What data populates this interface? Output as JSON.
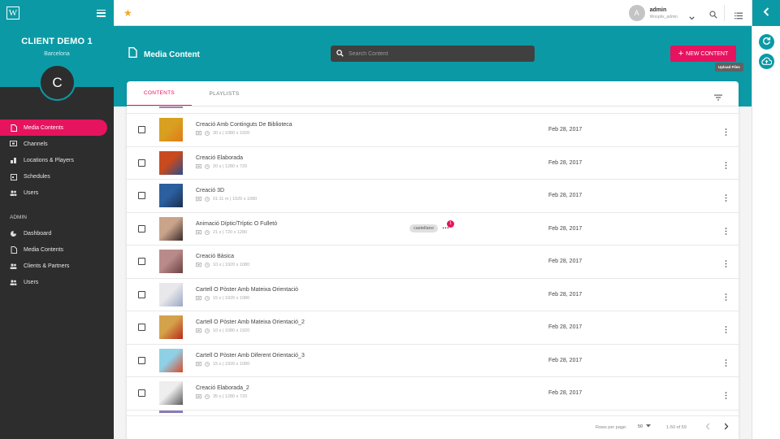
{
  "sidebar": {
    "logo": "W",
    "client_name": "CLIENT DEMO 1",
    "client_city": "Barcelona",
    "avatar_letter": "C",
    "items": [
      {
        "label": "Media Contents",
        "icon": "file-icon"
      },
      {
        "label": "Channels",
        "icon": "tv-icon"
      },
      {
        "label": "Locations & Players",
        "icon": "location-icon"
      },
      {
        "label": "Schedules",
        "icon": "calendar-icon"
      },
      {
        "label": "Users",
        "icon": "users-icon"
      }
    ],
    "admin_section": "ADMIN",
    "admin_items": [
      {
        "label": "Dashboard",
        "icon": "dashboard-icon"
      },
      {
        "label": "Media Contents",
        "icon": "file-icon"
      },
      {
        "label": "Clients & Partners",
        "icon": "clients-icon"
      },
      {
        "label": "Users",
        "icon": "users-icon"
      }
    ]
  },
  "header": {
    "user_initial": "A",
    "user_name": "admin",
    "user_sub": "Wooptix_admin"
  },
  "page": {
    "title": "Media Content",
    "search_placeholder": "Search Content",
    "new_button": "NEW CONTENT",
    "tooltip": "Upload Files"
  },
  "tabs": [
    "CONTENTS",
    "PLAYLISTS"
  ],
  "rows": [
    {
      "name": "Creació Amb Continguts De Biblioteca",
      "meta": "30 s | 1080 x 1920",
      "date": "Feb 28, 2017",
      "thumb": [
        "#d8a020",
        "#e27a1a"
      ]
    },
    {
      "name": "Creació Elaborada",
      "meta": "20 s | 1280 x 720",
      "date": "Feb 28, 2017",
      "thumb": [
        "#c94a1d",
        "#2a4d8a"
      ]
    },
    {
      "name": "Creació 3D",
      "meta": "01:11 m | 1920 x 1080",
      "date": "Feb 28, 2017",
      "thumb": [
        "#2b5f9e",
        "#1c2f4f"
      ]
    },
    {
      "name": "Animació Díptic/Tríptic O Fulletó",
      "meta": "21 s | 720 x 1280",
      "date": "Feb 28, 2017",
      "thumb": [
        "#c9a48a",
        "#3a2a2a"
      ],
      "tag": "castellano",
      "badge": "1"
    },
    {
      "name": "Creació Bàsica",
      "meta": "10 s | 1920 x 1080",
      "date": "Feb 28, 2017",
      "thumb": [
        "#b98a8a",
        "#6a4040"
      ]
    },
    {
      "name": "Cartell O Pòster Amb Mateixa Orientació",
      "meta": "15 s | 1920 x 1080",
      "date": "Feb 28, 2017",
      "thumb": [
        "#e8e8ea",
        "#9aa7c6"
      ]
    },
    {
      "name": "Cartell O Pòster Amb Mateixa Orientació_2",
      "meta": "10 s | 1080 x 1920",
      "date": "Feb 28, 2017",
      "thumb": [
        "#d4a24a",
        "#b82a1a"
      ]
    },
    {
      "name": "Cartell O Pòster Amb Diferent Orientació_3",
      "meta": "15 s | 1920 x 1080",
      "date": "Feb 28, 2017",
      "thumb": [
        "#8fd0e6",
        "#d94a2a"
      ]
    },
    {
      "name": "Creació Elaborada_2",
      "meta": "35 s | 1280 x 720",
      "date": "Feb 28, 2017",
      "thumb": [
        "#eeeeee",
        "#5a5a5a"
      ]
    }
  ],
  "pager": {
    "rows_label": "Rows per page:",
    "rows_value": "50",
    "range": "1-50 of 59"
  },
  "colors": {
    "teal": "#0b9aa5",
    "accent": "#e6135e",
    "sidebar": "#2d2d2d"
  }
}
